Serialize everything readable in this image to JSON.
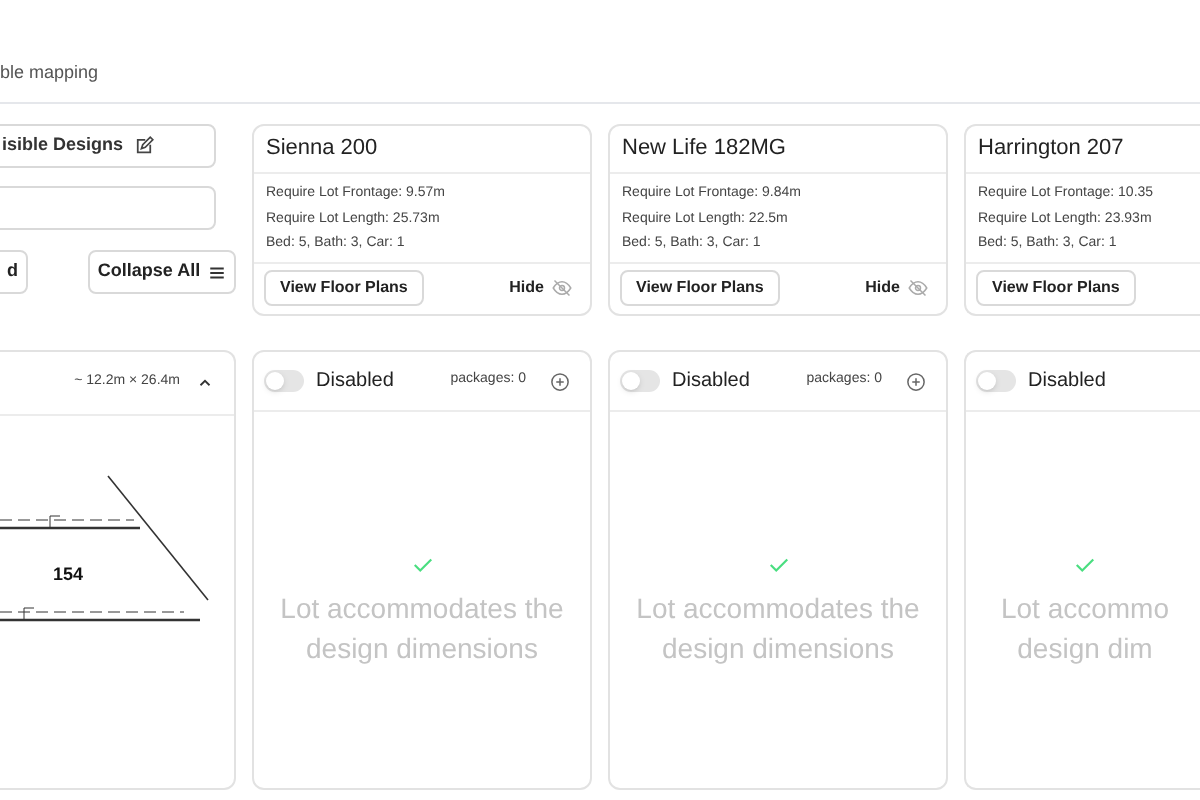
{
  "header": {
    "subtitle": "ble mapping"
  },
  "controls": {
    "visible_designs_button": "isible Designs",
    "expand_button": "d",
    "collapse_button": "Collapse All"
  },
  "lot": {
    "dimensions": "~ 12.2m × 26.4m",
    "expanded": true,
    "lot_number": "154"
  },
  "designs": [
    {
      "name": "Sienna 200",
      "frontage": "Require Lot Frontage: 9.57m",
      "length": "Require Lot Length: 25.73m",
      "rooms": "Bed: 5,  Bath: 3,  Car: 1",
      "view_button": "View Floor Plans",
      "hide_label": "Hide",
      "enabled": false,
      "toggle_label": "Disabled",
      "packages": "packages: 0",
      "message": [
        "Lot accommodates the",
        "design dimensions"
      ]
    },
    {
      "name": "New Life 182MG",
      "frontage": "Require Lot Frontage: 9.84m",
      "length": "Require Lot Length: 22.5m",
      "rooms": "Bed: 5,  Bath: 3,  Car: 1",
      "view_button": "View Floor Plans",
      "hide_label": "Hide",
      "enabled": false,
      "toggle_label": "Disabled",
      "packages": "packages: 0",
      "message": [
        "Lot accommodates the",
        "design dimensions"
      ]
    },
    {
      "name": "Harrington 207",
      "frontage": "Require Lot Frontage: 10.35",
      "length": "Require Lot Length: 23.93m",
      "rooms": "Bed: 5,  Bath: 3,  Car: 1",
      "view_button": "View Floor Plans",
      "enabled": false,
      "toggle_label": "Disabled",
      "message": [
        "Lot accommo",
        "design dim"
      ]
    }
  ]
}
